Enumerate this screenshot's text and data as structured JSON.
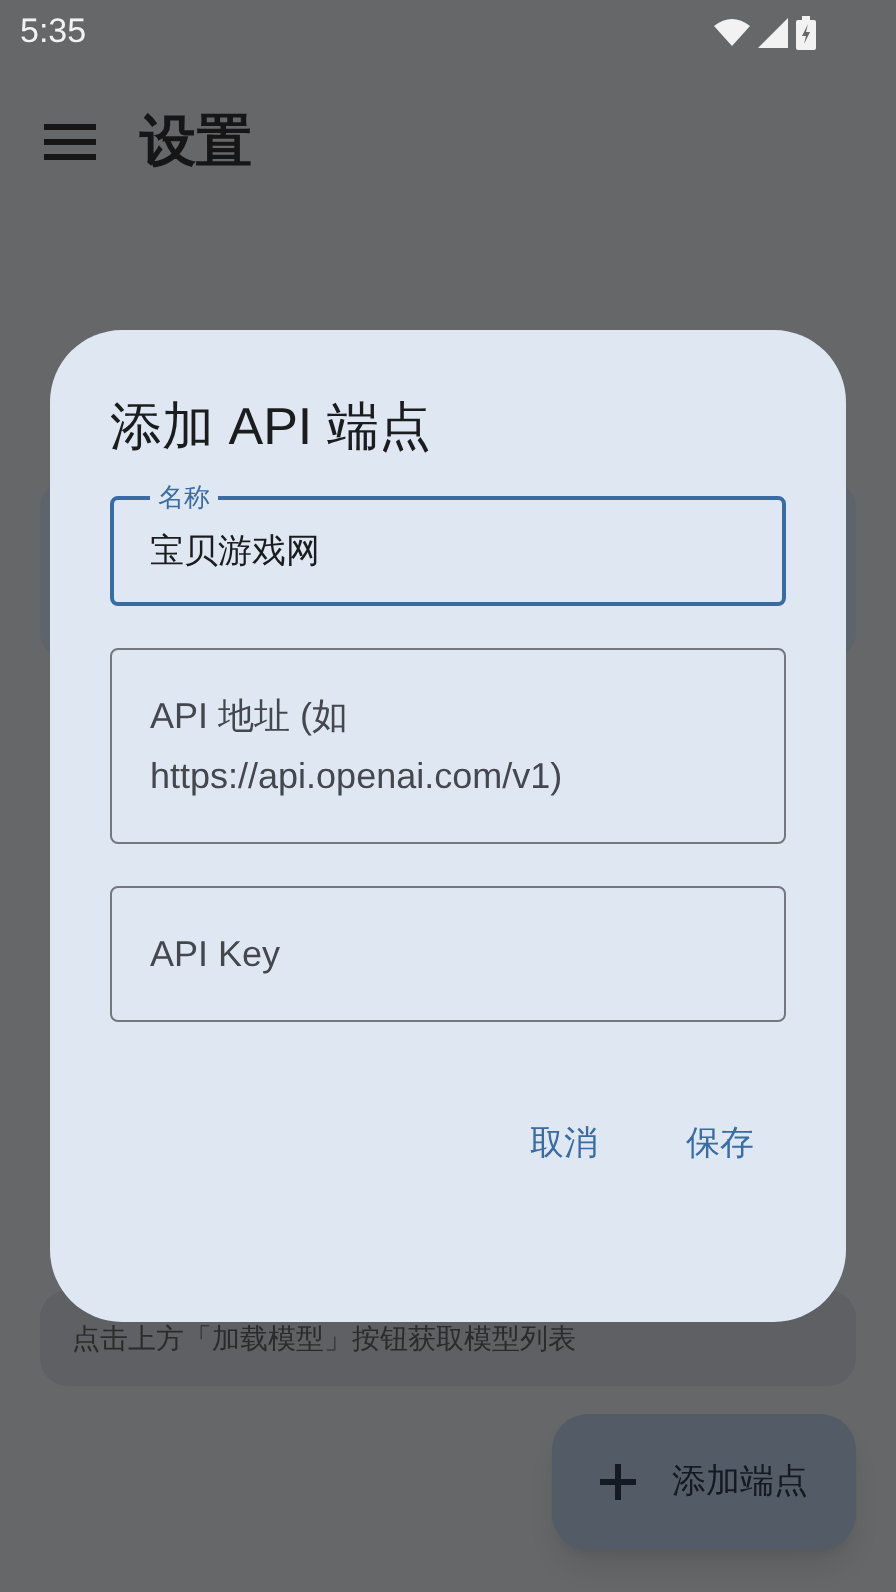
{
  "status_bar": {
    "time": "5:35"
  },
  "app_bar": {
    "title": "设置"
  },
  "hint": "点击上方「加载模型」按钮获取模型列表",
  "fab": {
    "label": "添加端点"
  },
  "dialog": {
    "title": "添加 API 端点",
    "fields": [
      {
        "label": "名称",
        "value": "宝贝游戏网",
        "focused": true
      },
      {
        "placeholder": "API 地址 (如 https://api.openai.com/v1)",
        "focused": false
      },
      {
        "placeholder": "API Key",
        "focused": false
      }
    ],
    "buttons": [
      "取消",
      "保存"
    ]
  }
}
